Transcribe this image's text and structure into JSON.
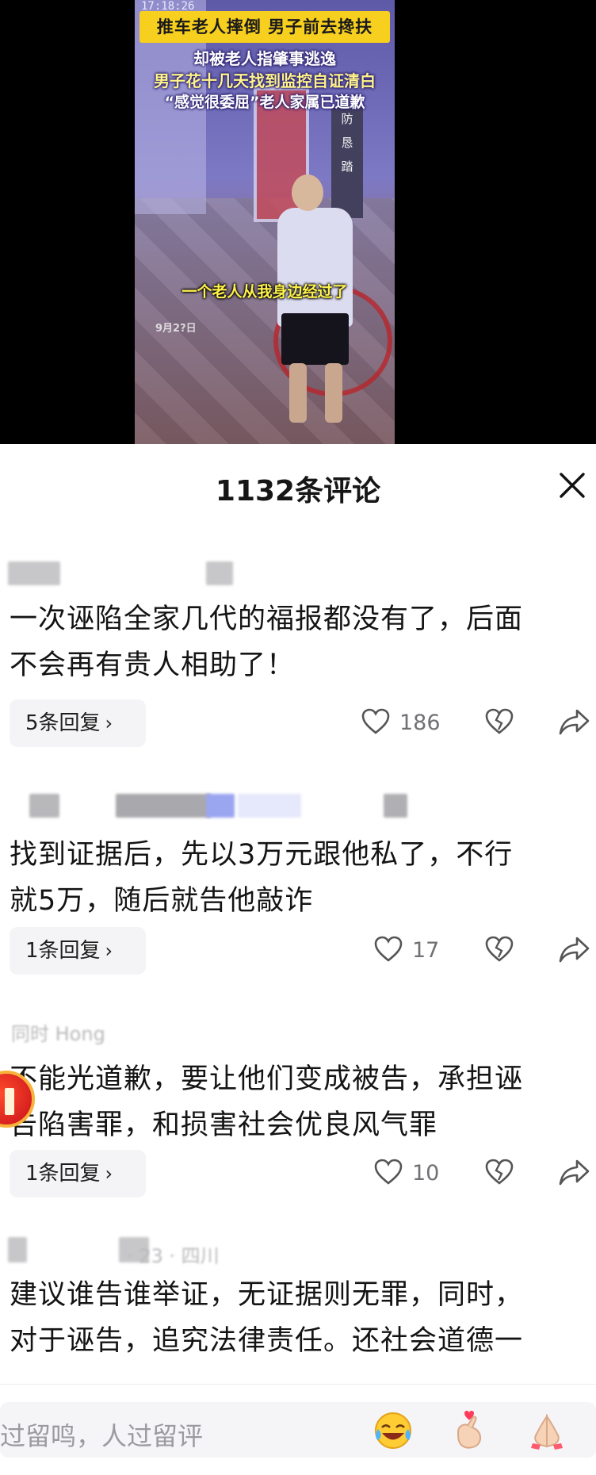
{
  "video": {
    "clock": "17:18:26",
    "headline": "推车老人摔倒 男子前去搀扶",
    "subline1": "却被老人指肇事逃逸",
    "subline2": "男子花十几天找到监控自证清白",
    "subline3": "“感觉很委屈”老人家属已道歉",
    "caption": "一个老人从我身边经过了",
    "date": "9月2?日",
    "sign_chars": [
      "防",
      "恳",
      "踏"
    ]
  },
  "comments_panel": {
    "title": "1132条评论",
    "close_icon": "close-icon"
  },
  "comments": [
    {
      "author_partial": "",
      "text_lines": [
        "一次诬陷全家几代的福报都没有了，后面",
        "不会再有贵人相助了！"
      ],
      "replies_label": "5条回复",
      "likes": "186"
    },
    {
      "author_partial": "",
      "text_lines": [
        "找到证据后，先以3万元跟他私了，不行",
        "就5万，随后就告他敲诈"
      ],
      "replies_label": "1条回复",
      "likes": "17"
    },
    {
      "author_partial": "同时 Hong",
      "text_lines": [
        "不能光道歉，要让他们变成被告，承担诬",
        "告陷害罪，和损害社会优良风气罪"
      ],
      "replies_label": "1条回复",
      "likes": "10"
    },
    {
      "author_partial": "· 23 · 四川",
      "text_lines": [
        "建议谁告谁举证，无证据则无罪，同时，",
        "对于诬告，追究法律责任。还社会道德一"
      ]
    }
  ],
  "input_bar": {
    "placeholder": "过留鸣，人过留评",
    "emojis": [
      "laughing-crying-emoji-icon",
      "heart-hands-emoji-icon",
      "praying-hands-emoji-icon"
    ]
  },
  "colors": {
    "title_banner": "#f7cf1e",
    "caption": "#fff34a",
    "badge": "#e11a25"
  }
}
